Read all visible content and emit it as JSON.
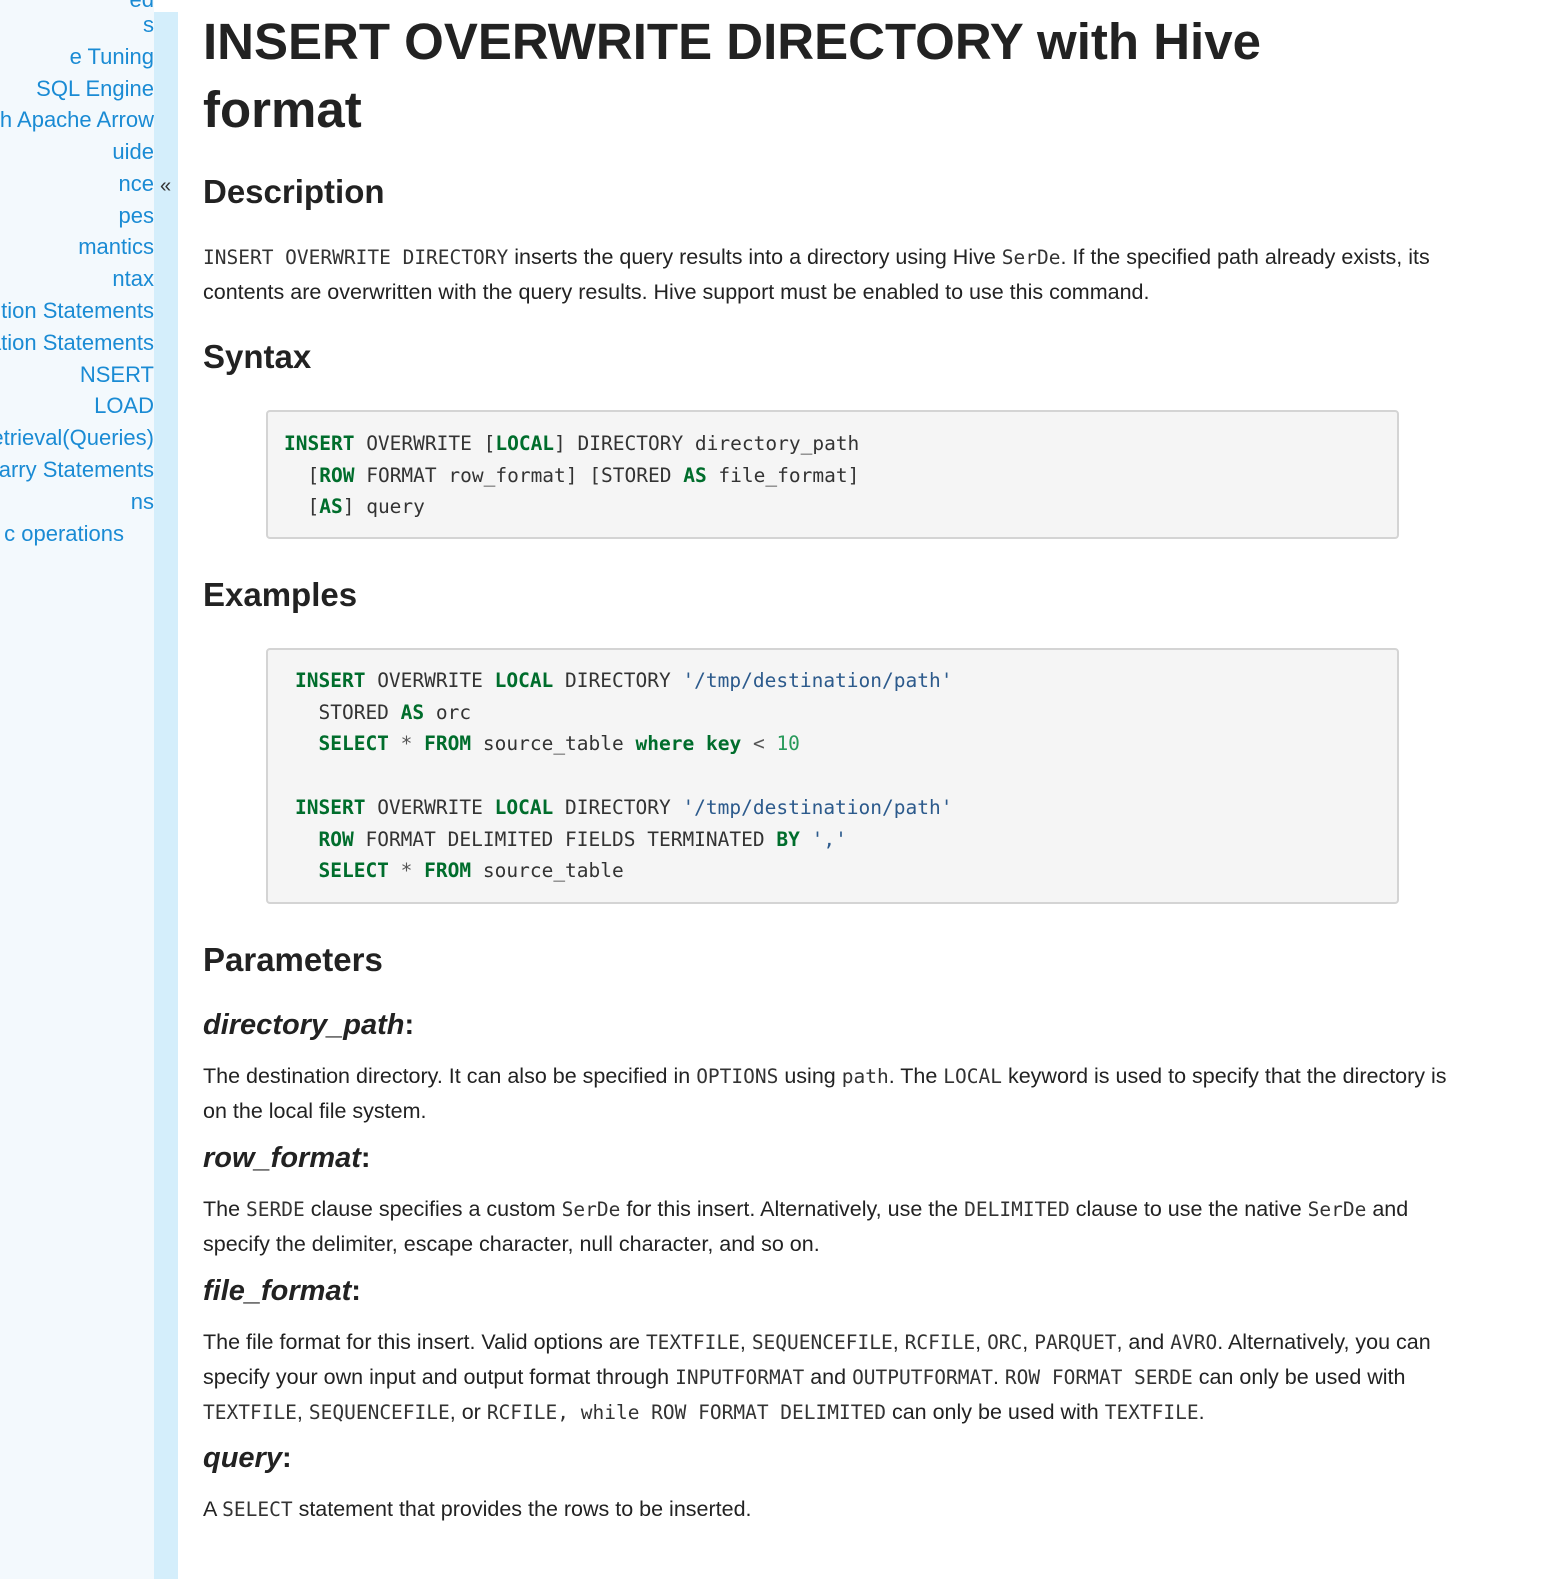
{
  "sidebar": {
    "items": [
      "ed",
      "s",
      "e Tuning",
      "SQL Engine",
      "age Guide for Pandas with Apache Arrow",
      "uide",
      "nce",
      "pes",
      "mantics",
      "ntax",
      "a Definition Statements",
      "a Manipulation Statements",
      "NSERT",
      "LOAD",
      "a Retrieval(Queries)",
      "ilarry Statements",
      "ns",
      "c operations"
    ]
  },
  "collapse": {
    "label": "«"
  },
  "page": {
    "title": "INSERT OVERWRITE DIRECTORY with Hive format",
    "description": {
      "heading": "Description",
      "code1": "INSERT OVERWRITE DIRECTORY",
      "text1": " inserts the query results into a directory using Hive ",
      "code2": "SerDe",
      "text2": ". If the specified path already exists, its contents are overwritten with the query results. Hive support must be enabled to use this command."
    },
    "syntax": {
      "heading": "Syntax",
      "lines": [
        [
          [
            "kw",
            "INSERT"
          ],
          [
            "t",
            " OVERWRITE ["
          ],
          [
            "kw",
            "LOCAL"
          ],
          [
            "t",
            "] DIRECTORY directory_path"
          ]
        ],
        [
          [
            "t",
            "  ["
          ],
          [
            "kw",
            "ROW"
          ],
          [
            "t",
            " FORMAT row_format] [STORED "
          ],
          [
            "kw",
            "AS"
          ],
          [
            "t",
            " file_format]"
          ]
        ],
        [
          [
            "t",
            "  ["
          ],
          [
            "kw",
            "AS"
          ],
          [
            "t",
            "] query"
          ]
        ]
      ]
    },
    "examples": {
      "heading": "Examples",
      "lines": [
        [
          [
            "kw",
            "INSERT"
          ],
          [
            "t",
            " OVERWRITE "
          ],
          [
            "kw",
            "LOCAL"
          ],
          [
            "t",
            " DIRECTORY "
          ],
          [
            "str",
            "'/tmp/destination/path'"
          ]
        ],
        [
          [
            "t",
            "  STORED "
          ],
          [
            "kw",
            "AS"
          ],
          [
            "t",
            " orc"
          ]
        ],
        [
          [
            "t",
            "  "
          ],
          [
            "kw",
            "SELECT"
          ],
          [
            "op",
            " * "
          ],
          [
            "kw",
            "FROM"
          ],
          [
            "t",
            " source_table "
          ],
          [
            "kw",
            "where"
          ],
          [
            "t",
            " "
          ],
          [
            "kw",
            "key"
          ],
          [
            "op",
            " < "
          ],
          [
            "num",
            "10"
          ]
        ],
        [],
        [
          [
            "kw",
            "INSERT"
          ],
          [
            "t",
            " OVERWRITE "
          ],
          [
            "kw",
            "LOCAL"
          ],
          [
            "t",
            " DIRECTORY "
          ],
          [
            "str",
            "'/tmp/destination/path'"
          ]
        ],
        [
          [
            "t",
            "  "
          ],
          [
            "kw",
            "ROW"
          ],
          [
            "t",
            " FORMAT DELIMITED FIELDS TERMINATED "
          ],
          [
            "kw",
            "BY"
          ],
          [
            "t",
            " "
          ],
          [
            "str",
            "','"
          ]
        ],
        [
          [
            "t",
            "  "
          ],
          [
            "kw",
            "SELECT"
          ],
          [
            "op",
            " * "
          ],
          [
            "kw",
            "FROM"
          ],
          [
            "t",
            " source_table"
          ]
        ]
      ]
    },
    "parameters": {
      "heading": "Parameters",
      "directory_path": {
        "name": "directory_path",
        "colon": ":",
        "t1": "The destination directory. It can also be specified in ",
        "c1": "OPTIONS",
        "t2": " using ",
        "c2": "path",
        "t3": ". The ",
        "c3": "LOCAL",
        "t4": " keyword is used to specify that the directory is on the local file system."
      },
      "row_format": {
        "name": "row_format",
        "colon": ":",
        "t1": "The ",
        "c1": "SERDE",
        "t2": " clause specifies a custom ",
        "c2": "SerDe",
        "t3": " for this insert. Alternatively, use the ",
        "c3": "DELIMITED",
        "t4": " clause to use the native ",
        "c4": "SerDe",
        "t5": " and specify the delimiter, escape character, null character, and so on."
      },
      "file_format": {
        "name": "file_format",
        "colon": ":",
        "t1": "The file format for this insert. Valid options are ",
        "c1": "TEXTFILE",
        "t2": ", ",
        "c2": "SEQUENCEFILE",
        "t3": ", ",
        "c3": "RCFILE",
        "t4": ", ",
        "c4": "ORC",
        "t5": ", ",
        "c5": "PARQUET",
        "t6": ", and ",
        "c6": "AVRO",
        "t7": ". Alternatively, you can specify your own input and output format through ",
        "c7": "INPUTFORMAT",
        "t8": " and ",
        "c8": "OUTPUTFORMAT",
        "t9": ". ",
        "c9": "ROW FORMAT SERDE",
        "t10": " can only be used with ",
        "c10": "TEXTFILE",
        "t11": ", ",
        "c11": "SEQUENCEFILE",
        "t12": ", or ",
        "c12": "RCFILE, while ROW FORMAT DELIMITED",
        "t13": " can only be used with ",
        "c13": "TEXTFILE",
        "t14": "."
      },
      "query": {
        "name": "query",
        "colon": ":",
        "t1": "A ",
        "c1": "SELECT",
        "t2": " statement that provides the rows to be inserted."
      }
    }
  }
}
